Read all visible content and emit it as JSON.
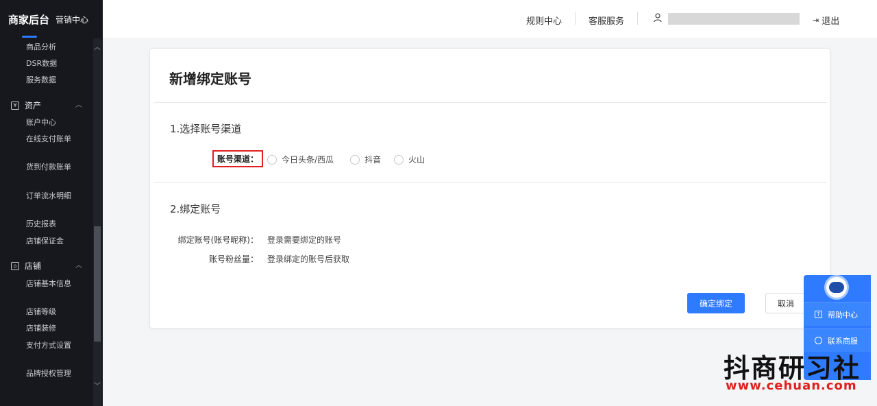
{
  "sidebar": {
    "brand": "商家后台",
    "brand_sub": "营销中心",
    "items_top": [
      "商品分析",
      "DSR数据",
      "服务数据"
    ],
    "group_assets": "资产",
    "assets_items": [
      "账户中心",
      "在线支付账单",
      "货到付款账单",
      "订单流水明细",
      "历史报表",
      "店铺保证金"
    ],
    "group_shop": "店铺",
    "shop_items": [
      "店铺基本信息",
      "店铺等级",
      "店铺装修",
      "支付方式设置",
      "品牌授权管理"
    ]
  },
  "topbar": {
    "rules": "规则中心",
    "service": "客服服务",
    "logout": "退出"
  },
  "card": {
    "title": "新增绑定账号",
    "section1": "1.选择账号渠道",
    "channel_label": "账号渠道：",
    "channels": [
      "今日头条/西瓜",
      "抖音",
      "火山"
    ],
    "section2": "2.绑定账号",
    "bind_label": "绑定账号(账号昵称)：",
    "bind_link": "登录需要绑定的账号",
    "fans_label": "账号粉丝量：",
    "fans_value": "登录绑定的账号后获取",
    "confirm": "确定绑定",
    "cancel": "取消"
  },
  "help": {
    "help_center": "帮助中心",
    "contact": "联系商服"
  },
  "watermark": {
    "title": "抖商研习社",
    "url": "www.cehuan.com"
  }
}
